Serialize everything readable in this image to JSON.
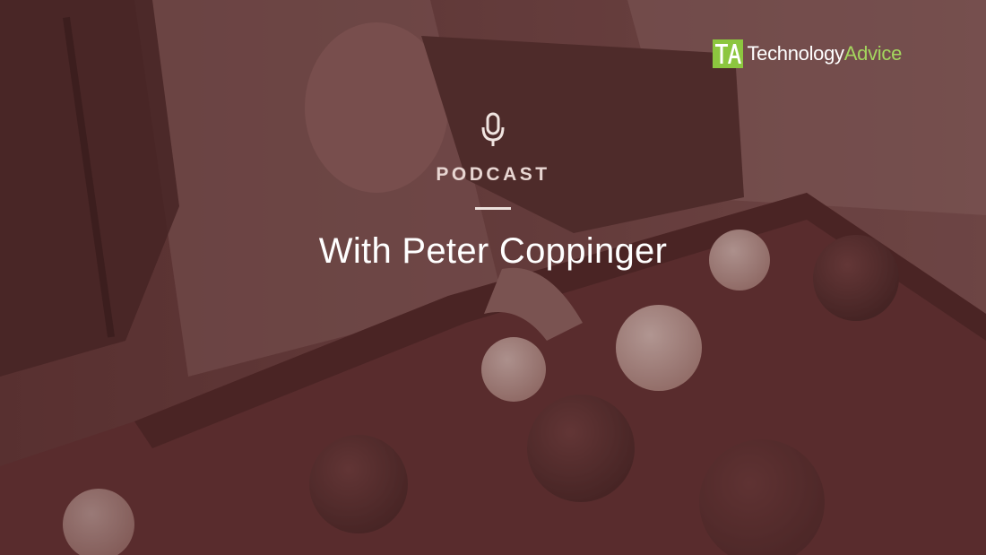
{
  "brand": {
    "mark": "TA",
    "name_part1": "Technology",
    "name_part2": "Advice",
    "mark_color": "#8cc63f",
    "accent_color": "#a4d65e"
  },
  "episode": {
    "icon": "microphone-icon",
    "eyebrow": "PODCAST",
    "title": "With Peter Coppinger"
  },
  "colors": {
    "overlay": "#6b3d3a",
    "text": "#ffffff"
  }
}
